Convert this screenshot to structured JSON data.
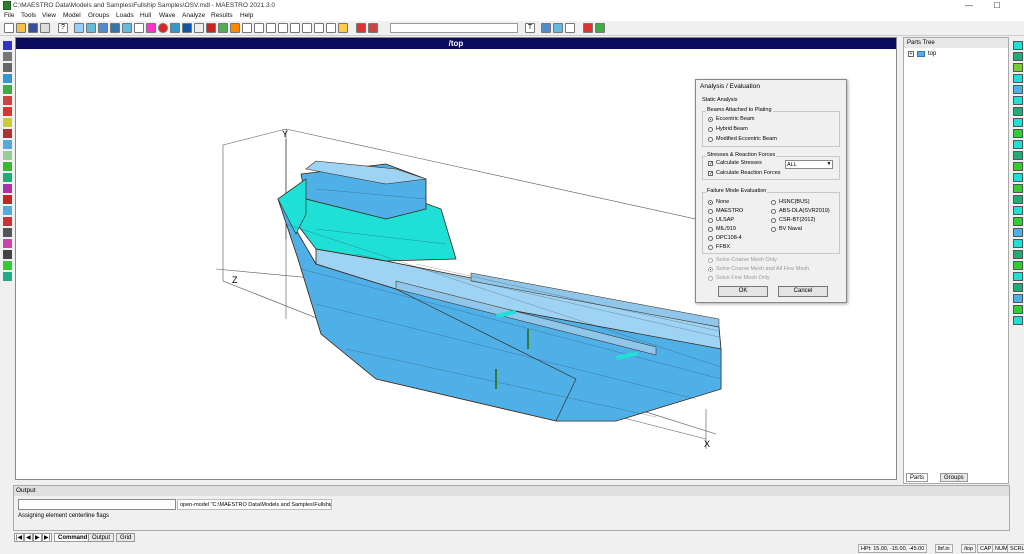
{
  "window": {
    "title": "C:\\MAESTRO Data\\Models and Samples\\Fullship Samples\\OSV.mdl - MAESTRO 2021.3.0",
    "minimize": "—",
    "maximize": "☐"
  },
  "menu": [
    "File",
    "Tools",
    "View",
    "Model",
    "Groups",
    "Loads",
    "Hull",
    "Wave",
    "Analyze",
    "Results",
    "Help"
  ],
  "toolbar": {
    "search_value": ""
  },
  "viewport": {
    "title": "/top",
    "axes": {
      "y": "Y",
      "z": "Z",
      "x": "X"
    },
    "colors": {
      "hull": "#4fb0e8",
      "deck": "#9fd3f3",
      "superstructure": "#1fe0d6",
      "edge": "#3a1f0a"
    }
  },
  "parts_tree": {
    "title": "Parts Tree",
    "root": "top",
    "tabs": [
      "Parts",
      "Groups"
    ]
  },
  "dialog": {
    "title": "Analysis / Evaluation",
    "section": "Static Analysis",
    "beam_group": {
      "label": "Beams Attached to Plating",
      "options": [
        "Eccentric Beam",
        "Hybrid Beam",
        "Modified Eccentric Beam"
      ],
      "selected": 0
    },
    "stress_group": {
      "label": "Stresses & Reaction Forces",
      "calc_stresses": "Calculate Stresses",
      "calc_reactions": "Calculate Reaction Forces",
      "stress_select": "ALL"
    },
    "failure_group": {
      "label": "Failure Mode Evaluation",
      "left": [
        "None",
        "MAESTRO",
        "ULSAP",
        "MIL/919",
        "DPC108-4",
        "FFBX"
      ],
      "right": [
        "HSNC(BUS)",
        "ABS-DLA(SVR2019)",
        "CSR-BT(2012)",
        "BV Naval"
      ],
      "selected": "None"
    },
    "mesh_options": [
      "Solve Coarse Mesh Only",
      "Solve Coarse Mesh and All Fine Mesh",
      "Solve Fine Mesh Only"
    ],
    "ok_label": "OK",
    "cancel_label": "Cancel"
  },
  "output": {
    "title": "Output",
    "command_value": "",
    "echo": "open-model \"C:\\MAESTRO Data\\Models and Samples\\Fullship",
    "message": "Assigning element centerline flags",
    "tabs": [
      "Command",
      "Output",
      "Grid"
    ],
    "nav": [
      "|◀",
      "◀",
      "▶",
      "▶|"
    ]
  },
  "status": [
    "HPt: 15.00, -15.00, -45.00",
    "lbf.in",
    "/top",
    "CAP",
    "NUM",
    "SCRL"
  ]
}
